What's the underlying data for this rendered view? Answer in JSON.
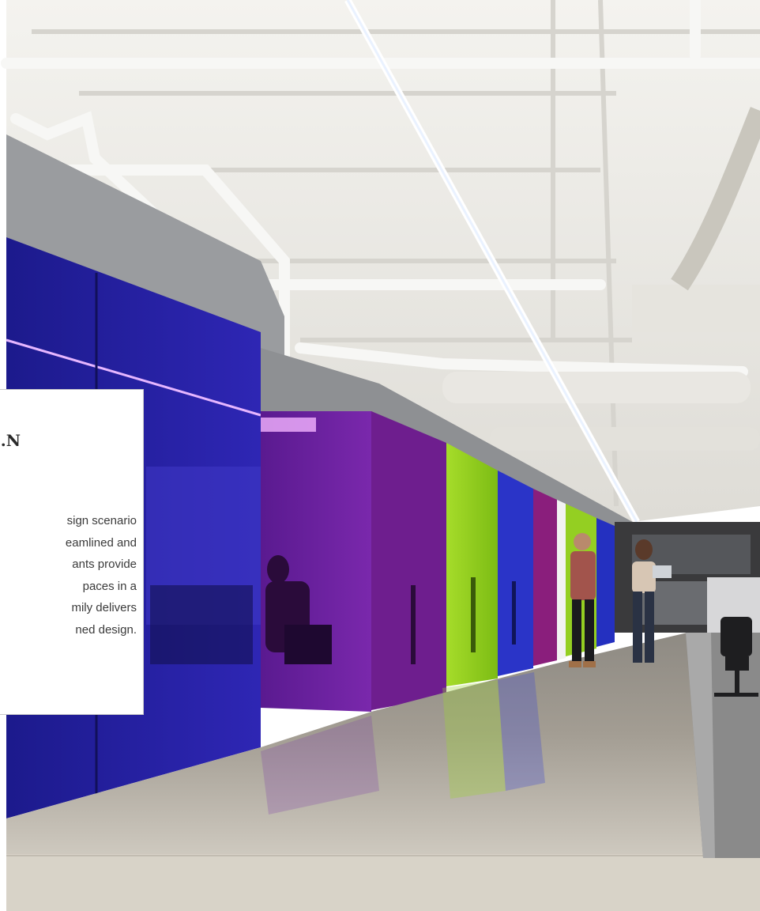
{
  "photo": {
    "subject": "office-corridor-colored-glass-walls",
    "colors": {
      "ceiling": "#eeeeea",
      "blue_glass": "#2a22a8",
      "purple_glass": "#6a1fa0",
      "green_glass": "#8ccf1c",
      "floor": "#b9b3a8"
    }
  },
  "card": {
    "heading": "N.",
    "lines": [
      "sign scenario",
      "eamlined and",
      "ants provide",
      "paces in a",
      "mily delivers",
      "ned design."
    ]
  }
}
